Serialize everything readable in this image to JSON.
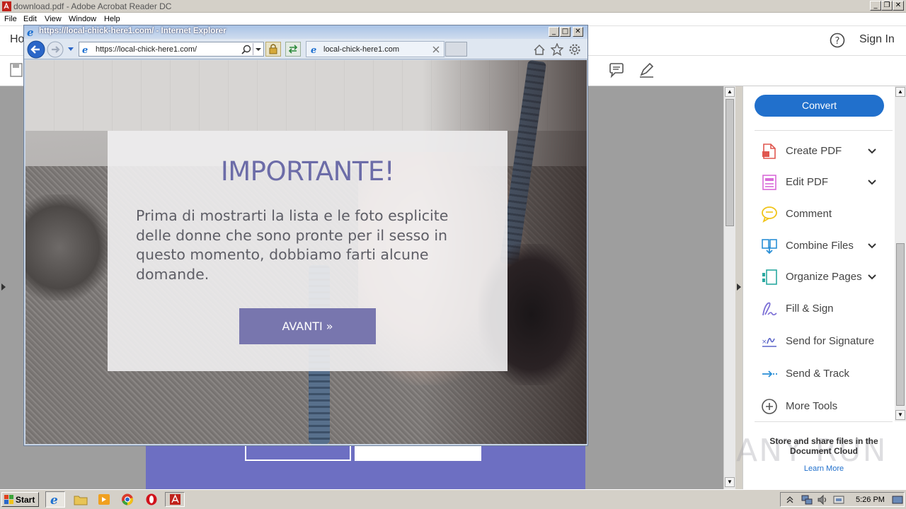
{
  "acrobat": {
    "title": "download.pdf - Adobe Acrobat Reader DC",
    "menu": [
      "File",
      "Edit",
      "View",
      "Window",
      "Help"
    ],
    "home_tab": "Ho",
    "sign_in": "Sign In",
    "help_icon": "?",
    "convert_label": "Convert",
    "tools": [
      {
        "label": "Create PDF",
        "icon": "create-pdf-icon",
        "chevron": true,
        "color": "#e0574f"
      },
      {
        "label": "Edit PDF",
        "icon": "edit-pdf-icon",
        "chevron": true,
        "color": "#d86ad8"
      },
      {
        "label": "Comment",
        "icon": "comment-icon",
        "chevron": false,
        "color": "#f0c419"
      },
      {
        "label": "Combine Files",
        "icon": "combine-files-icon",
        "chevron": true,
        "color": "#2a8fd6"
      },
      {
        "label": "Organize Pages",
        "icon": "organize-pages-icon",
        "chevron": true,
        "color": "#2aa8a0"
      },
      {
        "label": "Fill & Sign",
        "icon": "fill-sign-icon",
        "chevron": false,
        "color": "#7b6fd6"
      },
      {
        "label": "Send for Signature",
        "icon": "send-signature-icon",
        "chevron": false,
        "color": "#5a64c8"
      },
      {
        "label": "Send & Track",
        "icon": "send-track-icon",
        "chevron": false,
        "color": "#2a8fd6"
      },
      {
        "label": "More Tools",
        "icon": "more-tools-icon",
        "chevron": false,
        "color": "#555555"
      }
    ],
    "cloud_text": "Store and share files in the Document Cloud",
    "learn_more": "Learn More"
  },
  "ie": {
    "title": "https://local-chick-here1.com/ - Internet Explorer",
    "address": "https://local-chick-here1.com/",
    "tab_label": "local-chick-here1.com"
  },
  "modal": {
    "title": "IMPORTANTE!",
    "text": "Prima di mostrarti la lista e le foto esplicite delle donne che sono pronte per il sesso in questo momento, dobbiamo farti alcune domande.",
    "button": "AVANTI »"
  },
  "taskbar": {
    "start": "Start",
    "clock": "5:26 PM"
  },
  "watermark": "ANY RUN"
}
